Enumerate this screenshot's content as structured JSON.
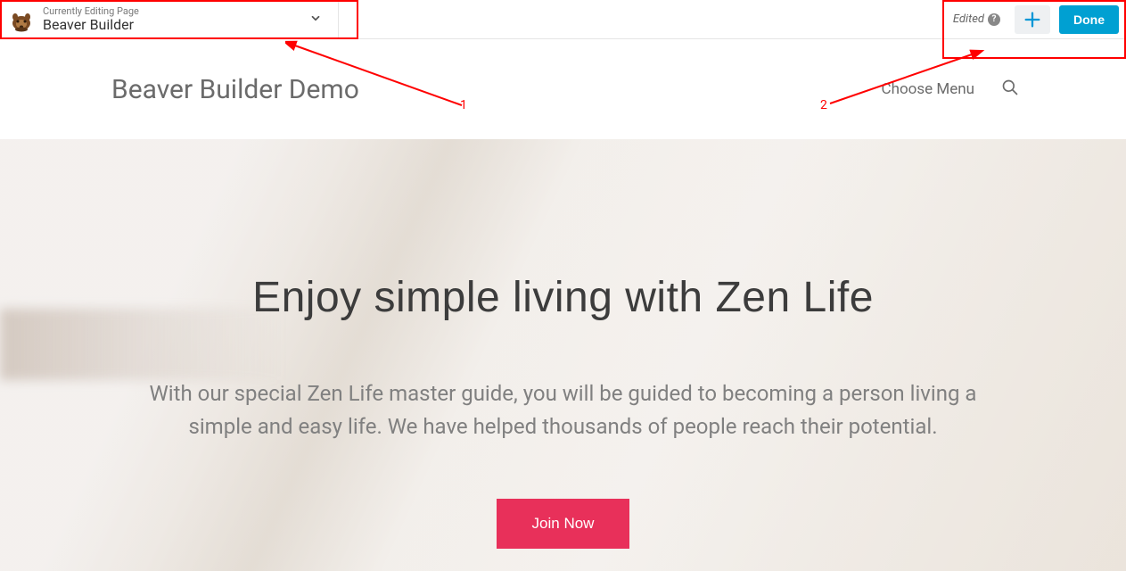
{
  "toolbar": {
    "editing_label": "Currently Editing Page",
    "page_name": "Beaver Builder",
    "edited_label": "Edited",
    "done_label": "Done"
  },
  "site": {
    "title": "Beaver Builder Demo",
    "menu_label": "Choose Menu"
  },
  "hero": {
    "title": "Enjoy simple living with Zen Life",
    "subtitle": "With our special Zen Life master guide, you will be guided to becoming a person living a simple and easy life. We have helped thousands of people reach their potential.",
    "cta_label": "Join Now"
  },
  "annotations": {
    "label_1": "1",
    "label_2": "2"
  }
}
